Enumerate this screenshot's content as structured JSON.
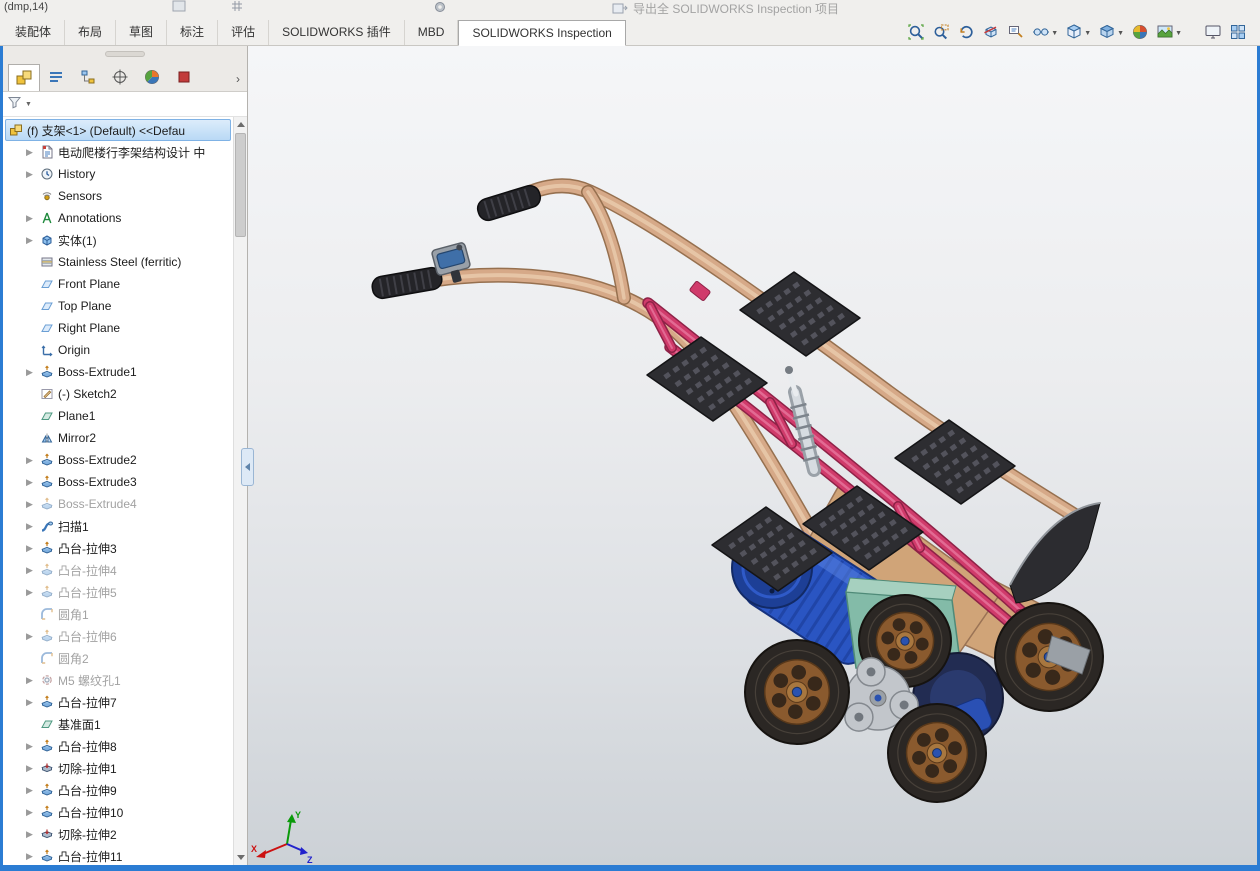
{
  "window": {
    "top_left_text": "(dmp,14)",
    "export_button_label": "导出全 SOLIDWORKS Inspection 项目"
  },
  "ribbon": {
    "tabs": [
      {
        "label": "装配体",
        "active": false
      },
      {
        "label": "布局",
        "active": false
      },
      {
        "label": "草图",
        "active": false
      },
      {
        "label": "标注",
        "active": false
      },
      {
        "label": "评估",
        "active": false
      },
      {
        "label": "SOLIDWORKS 插件",
        "active": false
      },
      {
        "label": "MBD",
        "active": false
      },
      {
        "label": "SOLIDWORKS Inspection",
        "active": true
      }
    ]
  },
  "headsup_toolbar": {
    "buttons": [
      {
        "name": "zoom-fit",
        "dropdown": false
      },
      {
        "name": "zoom-area",
        "dropdown": false
      },
      {
        "name": "previous-view",
        "dropdown": false
      },
      {
        "name": "section-view",
        "dropdown": false
      },
      {
        "name": "dynamic-annotation-views",
        "dropdown": false
      },
      {
        "name": "hide-show-items",
        "dropdown": true
      },
      {
        "name": "view-orientation",
        "dropdown": true
      },
      {
        "name": "display-style",
        "dropdown": true
      },
      {
        "name": "edit-appearance",
        "dropdown": false
      },
      {
        "name": "apply-scene",
        "dropdown": true
      },
      {
        "name": "view-settings",
        "dropdown": false
      },
      {
        "name": "options-grid",
        "dropdown": false
      }
    ]
  },
  "panel": {
    "tabs": [
      {
        "name": "feature-manager",
        "active": true
      },
      {
        "name": "property-manager",
        "active": false
      },
      {
        "name": "configuration-manager",
        "active": false
      },
      {
        "name": "dimxpert-manager",
        "active": false
      },
      {
        "name": "display-manager",
        "active": false
      },
      {
        "name": "addin-partial",
        "active": false
      }
    ],
    "chevron": "›",
    "filter_placeholder": "",
    "tree": {
      "root": {
        "label": "(f) 支架<1> (Default) <<Defau",
        "icon": "asm",
        "selected": true
      },
      "items": [
        {
          "label": "电动爬楼行李架结构设计 中",
          "icon": "doc",
          "expand": true,
          "grayed": false
        },
        {
          "label": "History",
          "icon": "history",
          "expand": true,
          "grayed": false
        },
        {
          "label": "Sensors",
          "icon": "sensors",
          "expand": false,
          "grayed": false
        },
        {
          "label": "Annotations",
          "icon": "annotations",
          "expand": true,
          "grayed": false
        },
        {
          "label": "实体(1)",
          "icon": "bodies",
          "expand": true,
          "grayed": false
        },
        {
          "label": "Stainless Steel (ferritic)",
          "icon": "material",
          "expand": false,
          "grayed": false
        },
        {
          "label": "Front Plane",
          "icon": "plane",
          "expand": false,
          "grayed": false
        },
        {
          "label": "Top Plane",
          "icon": "plane",
          "expand": false,
          "grayed": false
        },
        {
          "label": "Right Plane",
          "icon": "plane",
          "expand": false,
          "grayed": false
        },
        {
          "label": "Origin",
          "icon": "origin",
          "expand": false,
          "grayed": false
        },
        {
          "label": "Boss-Extrude1",
          "icon": "extrude",
          "expand": true,
          "grayed": false
        },
        {
          "label": "(-) Sketch2",
          "icon": "sketch",
          "expand": false,
          "grayed": false
        },
        {
          "label": "Plane1",
          "icon": "refplane",
          "expand": false,
          "grayed": false
        },
        {
          "label": "Mirror2",
          "icon": "mirror",
          "expand": false,
          "grayed": false
        },
        {
          "label": "Boss-Extrude2",
          "icon": "extrude",
          "expand": true,
          "grayed": false
        },
        {
          "label": "Boss-Extrude3",
          "icon": "extrude",
          "expand": true,
          "grayed": false
        },
        {
          "label": "Boss-Extrude4",
          "icon": "extrude",
          "expand": true,
          "grayed": true
        },
        {
          "label": "扫描1",
          "icon": "sweep",
          "expand": true,
          "grayed": false
        },
        {
          "label": "凸台-拉伸3",
          "icon": "extrude",
          "expand": true,
          "grayed": false
        },
        {
          "label": "凸台-拉伸4",
          "icon": "extrude",
          "expand": true,
          "grayed": true
        },
        {
          "label": "凸台-拉伸5",
          "icon": "extrude",
          "expand": true,
          "grayed": true
        },
        {
          "label": "圆角1",
          "icon": "fillet",
          "expand": false,
          "grayed": true
        },
        {
          "label": "凸台-拉伸6",
          "icon": "extrude",
          "expand": true,
          "grayed": true
        },
        {
          "label": "圆角2",
          "icon": "fillet",
          "expand": false,
          "grayed": true
        },
        {
          "label": "M5 螺纹孔1",
          "icon": "thread",
          "expand": true,
          "grayed": true
        },
        {
          "label": "凸台-拉伸7",
          "icon": "extrude",
          "expand": true,
          "grayed": false
        },
        {
          "label": "基准面1",
          "icon": "refplane",
          "expand": false,
          "grayed": false
        },
        {
          "label": "凸台-拉伸8",
          "icon": "extrude",
          "expand": true,
          "grayed": false
        },
        {
          "label": "切除-拉伸1",
          "icon": "cut",
          "expand": true,
          "grayed": false
        },
        {
          "label": "凸台-拉伸9",
          "icon": "extrude",
          "expand": true,
          "grayed": false
        },
        {
          "label": "凸台-拉伸10",
          "icon": "extrude",
          "expand": true,
          "grayed": false
        },
        {
          "label": "切除-拉伸2",
          "icon": "cut",
          "expand": true,
          "grayed": false
        },
        {
          "label": "凸台-拉伸11",
          "icon": "extrude",
          "expand": true,
          "grayed": false
        }
      ]
    }
  },
  "viewport": {
    "triad": {
      "x": "X",
      "y": "Y",
      "z": "Z"
    }
  },
  "colors": {
    "accent": "#2b7cd3",
    "tan": "#d6a988",
    "tan_dark": "#96704f",
    "pink": "#d03b6b",
    "pink_dark": "#8e2247",
    "pad": "#2d2d31",
    "motor": "#2a55c2",
    "motor_dark": "#16327e",
    "gear": "#83bba8",
    "rim": "#8a5a2e",
    "hub": "#2a52b0",
    "board": "#d0a478",
    "fin": "#2c2c30",
    "selection": "#bcd9f2"
  }
}
